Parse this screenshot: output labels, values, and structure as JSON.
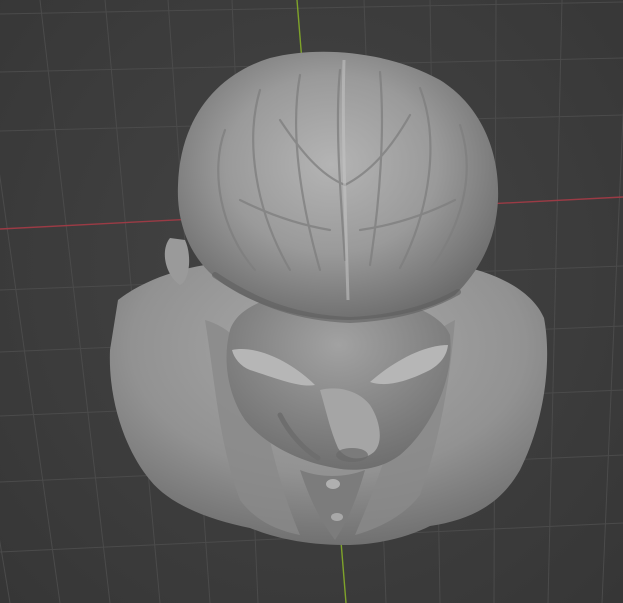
{
  "viewport": {
    "background_color": "#3d3d3d",
    "grid_color": "#4b4b4b",
    "x_axis_color": "#9b3b45",
    "y_axis_color": "#7fa32a",
    "model_color": "#8f8f8f",
    "view": "top-perspective"
  },
  "scene": {
    "object": "sculpted-bust"
  }
}
